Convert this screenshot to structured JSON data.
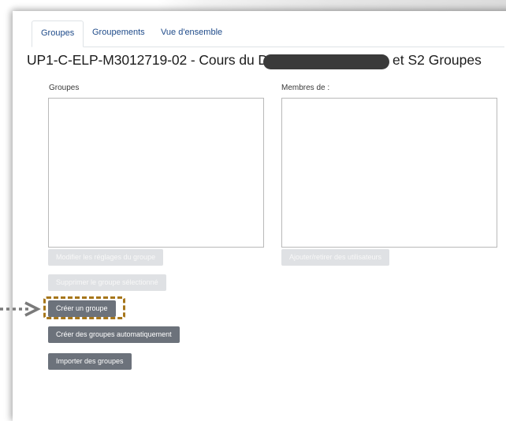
{
  "tabs": [
    {
      "label": "Groupes",
      "active": true
    },
    {
      "label": "Groupements",
      "active": false
    },
    {
      "label": "Vue d'ensemble",
      "active": false
    }
  ],
  "page": {
    "title": "UP1-C-ELP-M3012719-02 - Cours du Dr.",
    "title_suffix": "et S2 Groupes"
  },
  "groups_panel": {
    "label": "Groupes",
    "buttons": {
      "edit": "Modifier les réglages du groupe",
      "delete": "Supprimer le groupe sélectionné",
      "create": "Créer un groupe",
      "auto_create": "Créer des groupes automatiquement",
      "import": "Importer des groupes"
    }
  },
  "members_panel": {
    "label": "Membres de :",
    "buttons": {
      "add_remove": "Ajouter/retirer des utilisateurs"
    }
  },
  "annotation": {
    "highlight_color": "#a6761b",
    "arrow_color": "#7a7a7a"
  }
}
